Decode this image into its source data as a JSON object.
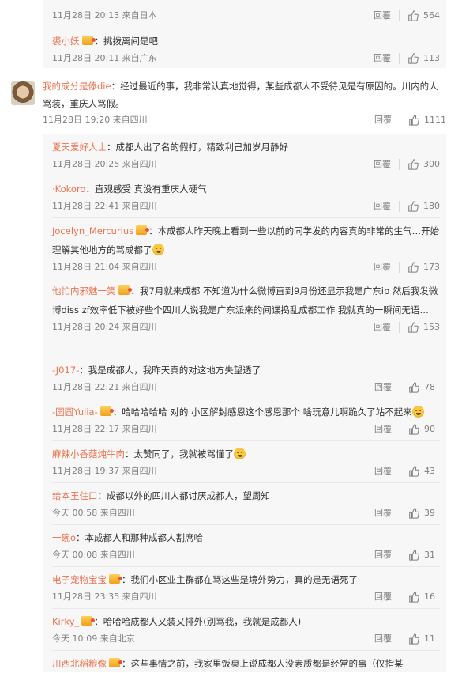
{
  "like_icon": "thumb-up-icon",
  "reply_label": "回覆",
  "top_partial": {
    "time": "11月28日 20:13 来自日本",
    "likes": "564"
  },
  "first_reply": {
    "user": "裘小妖",
    "text": "：挑拨离间是吧",
    "time": "11月28日 20:11 来自广东",
    "likes": "113"
  },
  "main_comment": {
    "user": "我的成分是傣die",
    "text": "：经过最近的事，我非常认真地觉得，某些成都人不受待见是有原因的。川内的人骂装，重庆人骂假。",
    "time": "11月28日 19:20 来自四川",
    "likes": "1111"
  },
  "replies": [
    {
      "user": "夏天爱好人士",
      "text": "：成都人出了名的假打，精致利己加岁月静好",
      "time": "11月28日 20:25 来自四川",
      "likes": "300"
    },
    {
      "user": "·Kokoro",
      "text": "：直观感受 真没有重庆人硬气",
      "time": "11月28日 22:41 来自四川",
      "likes": "180"
    },
    {
      "user": "Jocelyn_Mercurius",
      "text": "：本成都人昨天晚上看到一些以前的同学发的内容真的非常的生气…开始理解其他地方的骂成都了",
      "time": "11月28日 21:04 来自四川",
      "likes": "173"
    },
    {
      "user": "他忙内邪魅一笑",
      "text": "：我7月就来成都 不知道为什么微博直到9月份还显示我是广东ip 然后我发微博diss zf效率低下被好些个四川人说我是广东派来的间谍捣乱成都工作 我就真的一瞬间无语…",
      "time": "11月28日 20:24 来自四川",
      "likes": "153"
    },
    {
      "user": "-J017-",
      "text": "：我是成都人，我昨天真的对这地方失望透了",
      "time": "11月28日 22:21 来自四川",
      "likes": "78"
    },
    {
      "user": "-圆圆Yulia-",
      "text": "：哈哈哈哈哈 对的 小区解封感恩这个感恩那个 啥玩意儿啊跪久了站不起来",
      "time": "11月28日 22:17 来自四川",
      "likes": "90"
    },
    {
      "user": "麻辣小香菇炖牛肉",
      "text": "：太赞同了，我就被骂懂了",
      "time": "11月28日 19:37 来自四川",
      "likes": "43"
    },
    {
      "user": "给本王住口",
      "text": "：成都以外的四川人都讨厌成都人，望周知",
      "time": "今天 00:58 来自四川",
      "likes": "39"
    },
    {
      "user": "一碗o",
      "text": "：本成都人和那种成都人割席哈",
      "time": "今天 00:08 来自四川",
      "likes": "31"
    },
    {
      "user": "电子宠物宝宝",
      "text": "：我们小区业主群都在骂这些是境外势力，真的是无语死了",
      "time": "11月28日 23:35 来自四川",
      "likes": "16"
    },
    {
      "user": "Kirky_",
      "text": "：哈哈哈成都人又装又排外(别骂我，我就是成都人)",
      "time": "今天 10:09 来自北京",
      "likes": "11"
    },
    {
      "user": "川西北稻粮像",
      "text": "：这些事情之前，我家里饭桌上说成都人没素质都是经常的事（仅指某",
      "time": "",
      "likes": ""
    }
  ]
}
